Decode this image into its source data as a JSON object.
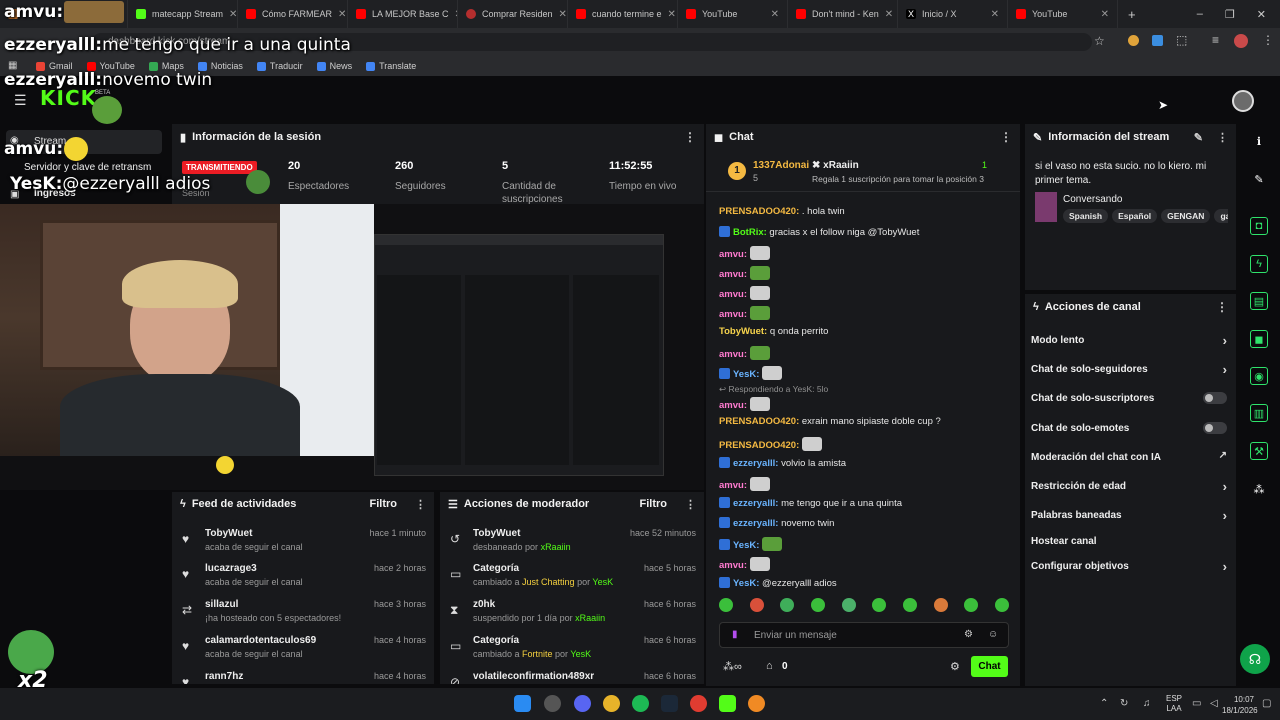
{
  "browser": {
    "tabs": [
      {
        "label": "",
        "color": "#c9762d"
      },
      {
        "label": "matecapp Stream",
        "color": "#53fc18"
      },
      {
        "label": "Cómo FARMEAR",
        "color": "#ff0000"
      },
      {
        "label": "LA MEJOR Base C",
        "color": "#ff0000"
      },
      {
        "label": "Comprar Residen",
        "color": "#b52e2e"
      },
      {
        "label": "cuando termine e",
        "color": "#ff0000"
      },
      {
        "label": "YouTube",
        "color": "#ff0000"
      },
      {
        "label": "Don't mind - Ken",
        "color": "#ff0000"
      },
      {
        "label": "Inicio / X",
        "color": "#ffffff"
      },
      {
        "label": "YouTube",
        "color": "#ff0000"
      }
    ],
    "url": "dashboard.kick.com/stream",
    "bookmarks": [
      "Gmail",
      "YouTube",
      "Maps",
      "Noticias",
      "Traducir",
      "News",
      "Translate"
    ]
  },
  "overlay": {
    "messages": [
      {
        "user": "amvu:",
        "text": ""
      },
      {
        "user": "ezzeryalll:",
        "text": "me tengo que ir a una quinta"
      },
      {
        "user": "ezzeryalll:",
        "text": "novemo twin"
      },
      {
        "user": "amvu:",
        "text": ""
      },
      {
        "user": "YesK:",
        "text": "@ezzeryalll adios"
      }
    ],
    "corner_label": "x2"
  },
  "nav": {
    "brand": "KICK",
    "brand_sup": "BETA",
    "items": [
      "Stream",
      "Servidor y clave de retransm",
      "Ingresos"
    ]
  },
  "session": {
    "title": "Información de la sesión",
    "live_badge": "TRANSMITIENDO",
    "session_sub": "Sesión",
    "stats": [
      {
        "value": "20",
        "label": "Espectadores"
      },
      {
        "value": "260",
        "label": "Seguidores"
      },
      {
        "value": "5",
        "label": "Cantidad de suscripciones"
      },
      {
        "value": "11:52:55",
        "label": "Tiempo en vivo"
      }
    ]
  },
  "feed": {
    "title": "Feed de actividades",
    "filter": "Filtro",
    "items": [
      {
        "who": "TobyWuet",
        "sub": "acaba de seguir el canal",
        "when": "hace 1 minuto"
      },
      {
        "who": "lucazrage3",
        "sub": "acaba de seguir el canal",
        "when": "hace 2 horas"
      },
      {
        "who": "sillazul",
        "sub": "¡ha hosteado con 5 espectadores!",
        "when": "hace 3 horas"
      },
      {
        "who": "calamardotentaculos69",
        "sub": "acaba de seguir el canal",
        "when": "hace 4 horas"
      },
      {
        "who": "rann7hz",
        "sub": "",
        "when": "hace 4 horas"
      }
    ]
  },
  "modactions": {
    "title": "Acciones de moderador",
    "filter": "Filtro",
    "items": [
      {
        "who": "TobyWuet",
        "sub_a": "desbaneado por ",
        "sub_b": "xRaaiin",
        "when": "hace 52 minutos"
      },
      {
        "who": "Categoría",
        "sub_a": "cambiado a ",
        "sub_b": "Just Chatting",
        "sub_c": " por ",
        "sub_d": "YesK",
        "when": "hace 5 horas"
      },
      {
        "who": "z0hk",
        "sub_a": "suspendido por 1 día por ",
        "sub_b": "xRaaiin",
        "when": "hace 6 horas"
      },
      {
        "who": "Categoría",
        "sub_a": "cambiado a ",
        "sub_b": "Fortnite",
        "sub_c": " por ",
        "sub_d": "YesK",
        "when": "hace 6 horas"
      },
      {
        "who": "volatileconfirmation489xr",
        "sub_a": "",
        "sub_b": "",
        "when": "hace 6 horas"
      }
    ]
  },
  "chat": {
    "title": "Chat",
    "pinned": {
      "rank": "1",
      "user": "1337Adonai",
      "count": "5",
      "top": "xRaaiin",
      "top_count": "1",
      "gift_text": "Regala 1 suscripción para tomar la posición 3"
    },
    "messages": [
      {
        "user": "PRENSADOO420:",
        "text": ". hola twin",
        "cls": "u-orange"
      },
      {
        "user": "BotRix:",
        "text": "gracias x el follow niga @TobyWuet",
        "cls": "u-green"
      },
      {
        "user": "amvu:",
        "text": "",
        "cls": "u-pink"
      },
      {
        "user": "amvu:",
        "text": "",
        "cls": "u-pink"
      },
      {
        "user": "amvu:",
        "text": "",
        "cls": "u-pink"
      },
      {
        "user": "amvu:",
        "text": "",
        "cls": "u-pink"
      },
      {
        "user": "TobyWuet:",
        "text": "q onda perrito",
        "cls": "u-yellow"
      },
      {
        "user": "amvu:",
        "text": "",
        "cls": "u-pink"
      },
      {
        "user": "YesK:",
        "text": "",
        "cls": "u-blue"
      },
      {
        "user": "Respondiendo a YesK:",
        "text": "5lo",
        "cls": "reply"
      },
      {
        "user": "amvu:",
        "text": "",
        "cls": "u-pink"
      },
      {
        "user": "PRENSADOO420:",
        "text": "exrain mano sipiaste doble cup ?",
        "cls": "u-orange"
      },
      {
        "user": "PRENSADOO420:",
        "text": "",
        "cls": "u-orange"
      },
      {
        "user": "ezzeryalll:",
        "text": "volvio la amista",
        "cls": "u-blue"
      },
      {
        "user": "amvu:",
        "text": "",
        "cls": "u-pink"
      },
      {
        "user": "ezzeryalll:",
        "text": "me tengo que ir a una quinta",
        "cls": "u-blue"
      },
      {
        "user": "ezzeryalll:",
        "text": "novemo twin",
        "cls": "u-blue"
      },
      {
        "user": "YesK:",
        "text": "",
        "cls": "u-blue"
      },
      {
        "user": "amvu:",
        "text": "",
        "cls": "u-pink"
      },
      {
        "user": "YesK:",
        "text": "@ezzeryalll adios",
        "cls": "u-blue"
      }
    ],
    "input_placeholder": "Enviar un mensaje",
    "points": "0",
    "send_label": "Chat"
  },
  "streaminfo": {
    "title": "Información del stream",
    "stream_title": "si el vaso no esta sucio. no lo kiero. mi primer tema.",
    "category": "Conversando",
    "tags": [
      "Spanish",
      "Español",
      "GENGAN",
      "gar"
    ]
  },
  "channel_actions": {
    "title": "Acciones de canal",
    "items": [
      {
        "label": "Modo lento",
        "kind": "chevron"
      },
      {
        "label": "Chat de solo-seguidores",
        "kind": "chevron"
      },
      {
        "label": "Chat de solo-suscriptores",
        "kind": "toggle"
      },
      {
        "label": "Chat de solo-emotes",
        "kind": "toggle"
      },
      {
        "label": "Moderación del chat con IA",
        "kind": "external"
      },
      {
        "label": "Restricción de edad",
        "kind": "chevron"
      },
      {
        "label": "Palabras baneadas",
        "kind": "chevron"
      },
      {
        "label": "Hostear canal",
        "kind": "none"
      },
      {
        "label": "Configurar objetivos",
        "kind": "chevron"
      }
    ]
  },
  "taskbar": {
    "lang": "ESP",
    "lang2": "LAA",
    "time": "10:07",
    "date": "18/1/2026"
  },
  "colors": {
    "accent": "#53fc18",
    "panel": "#18191c",
    "live": "#eb1c24"
  }
}
